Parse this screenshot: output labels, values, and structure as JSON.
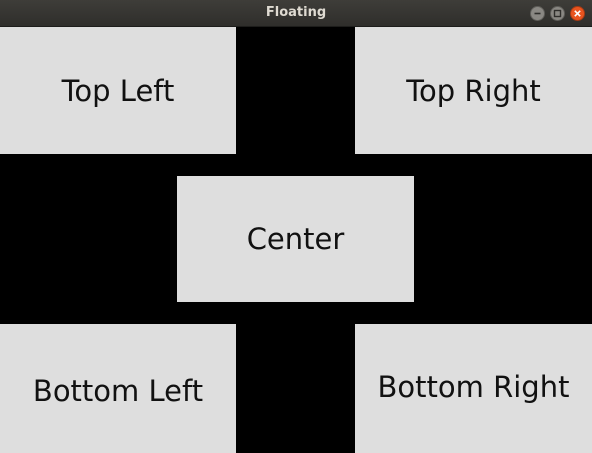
{
  "window": {
    "title": "Floating",
    "controls": {
      "minimize": "minimize-icon",
      "maximize": "maximize-icon",
      "close": "close-icon"
    },
    "close_color": "#e9541f"
  },
  "buttons": {
    "top_left": "Top Left",
    "top_right": "Top Right",
    "center": "Center",
    "bottom_left": "Bottom Left",
    "bottom_right": "Bottom Right"
  },
  "colors": {
    "background": "#000000",
    "button": "#dedede",
    "titlebar": "#3e3d39"
  }
}
